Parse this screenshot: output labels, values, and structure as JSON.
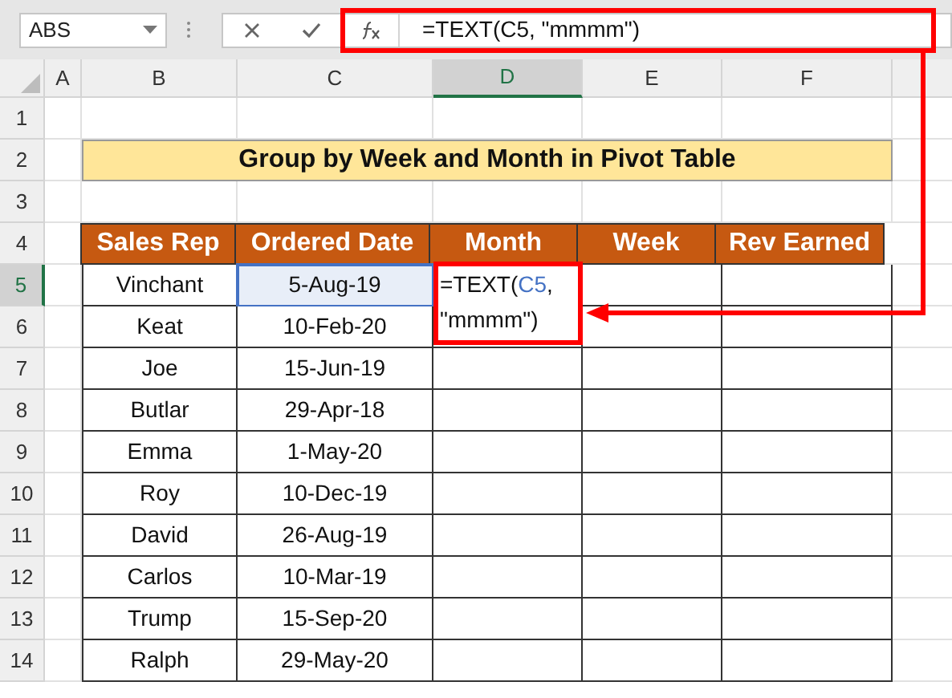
{
  "name_box": {
    "value": "ABS"
  },
  "formula_bar": {
    "value": "=TEXT(C5, \"mmmm\")"
  },
  "columns": [
    {
      "label": "A",
      "selected": false
    },
    {
      "label": "B",
      "selected": false
    },
    {
      "label": "C",
      "selected": false
    },
    {
      "label": "D",
      "selected": true
    },
    {
      "label": "E",
      "selected": false
    },
    {
      "label": "F",
      "selected": false
    }
  ],
  "title": "Group by Week and Month in Pivot Table",
  "table": {
    "columns": [
      "Sales Rep",
      "Ordered Date",
      "Month",
      "Week",
      "Rev Earned"
    ],
    "rows": [
      {
        "number": "5",
        "selected": true,
        "cells": [
          "Vinchant",
          "5-Aug-19"
        ]
      },
      {
        "number": "6",
        "selected": false,
        "cells": [
          "Keat",
          "10-Feb-20"
        ]
      },
      {
        "number": "7",
        "selected": false,
        "cells": [
          "Joe",
          "15-Jun-19"
        ]
      },
      {
        "number": "8",
        "selected": false,
        "cells": [
          "Butlar",
          "29-Apr-18"
        ]
      },
      {
        "number": "9",
        "selected": false,
        "cells": [
          "Emma",
          "1-May-20"
        ]
      },
      {
        "number": "10",
        "selected": false,
        "cells": [
          "Roy",
          "10-Dec-19"
        ]
      },
      {
        "number": "11",
        "selected": false,
        "cells": [
          "David",
          "26-Aug-19"
        ]
      },
      {
        "number": "12",
        "selected": false,
        "cells": [
          "Carlos",
          "10-Mar-19"
        ]
      },
      {
        "number": "13",
        "selected": false,
        "cells": [
          "Trump",
          "15-Sep-20"
        ]
      },
      {
        "number": "14",
        "selected": false,
        "cells": [
          "Ralph",
          "29-May-20"
        ]
      }
    ]
  },
  "top_rows": [
    "1",
    "2",
    "3",
    "4"
  ],
  "cell_editor": {
    "parts": [
      {
        "kind": "plain",
        "text": "=TEXT("
      },
      {
        "kind": "ref",
        "text": "C5"
      },
      {
        "kind": "plain",
        "text": ", \"mmmm\")"
      }
    ]
  }
}
